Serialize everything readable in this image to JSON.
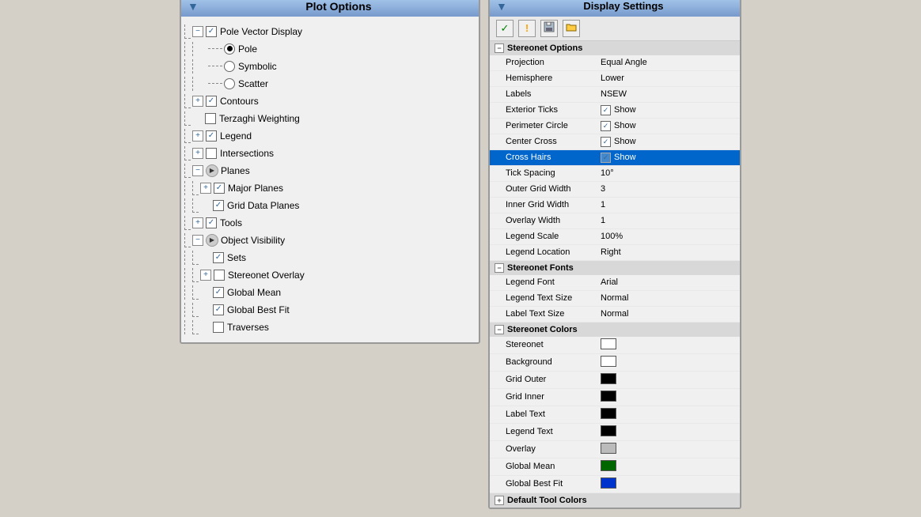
{
  "leftPanel": {
    "title": "Plot Options",
    "items": [
      {
        "label": "Pole Vector Display",
        "type": "minus-check",
        "checked": true,
        "indent": 0
      },
      {
        "label": "Pole",
        "type": "radio",
        "selected": true,
        "indent": 1
      },
      {
        "label": "Symbolic",
        "type": "radio",
        "selected": false,
        "indent": 1
      },
      {
        "label": "Scatter",
        "type": "radio",
        "selected": false,
        "indent": 1
      },
      {
        "label": "Contours",
        "type": "plus-check",
        "checked": true,
        "indent": 0
      },
      {
        "label": "Terzaghi Weighting",
        "type": "check",
        "checked": false,
        "indent": 0
      },
      {
        "label": "Legend",
        "type": "plus-check",
        "checked": true,
        "indent": 0
      },
      {
        "label": "Intersections",
        "type": "plus-check",
        "checked": false,
        "indent": 0
      },
      {
        "label": "Planes",
        "type": "minus-arrow",
        "indent": 0
      },
      {
        "label": "Major Planes",
        "type": "plus-check",
        "checked": true,
        "indent": 1
      },
      {
        "label": "Grid Data Planes",
        "type": "check",
        "checked": true,
        "indent": 1
      },
      {
        "label": "Tools",
        "type": "plus-check",
        "checked": true,
        "indent": 0
      },
      {
        "label": "Object Visibility",
        "type": "minus-arrow",
        "indent": 0
      },
      {
        "label": "Sets",
        "type": "check",
        "checked": true,
        "indent": 1
      },
      {
        "label": "Stereonet Overlay",
        "type": "plus-check",
        "checked": false,
        "indent": 1
      },
      {
        "label": "Global Mean",
        "type": "check",
        "checked": true,
        "indent": 1
      },
      {
        "label": "Global Best Fit",
        "type": "check",
        "checked": true,
        "indent": 1
      },
      {
        "label": "Traverses",
        "type": "check",
        "checked": false,
        "indent": 1
      }
    ]
  },
  "rightPanel": {
    "title": "Display Settings",
    "toolbar": {
      "checkmark": "✓",
      "exclaim": "!",
      "save": "💾",
      "folder": "📁"
    },
    "sections": [
      {
        "label": "Stereonet Options",
        "properties": [
          {
            "label": "Projection",
            "value": "Equal Angle",
            "type": "text"
          },
          {
            "label": "Hemisphere",
            "value": "Lower",
            "type": "text"
          },
          {
            "label": "Labels",
            "value": "NSEW",
            "type": "text"
          },
          {
            "label": "Exterior Ticks",
            "value": "Show",
            "type": "checkbox-show",
            "checked": true
          },
          {
            "label": "Perimeter Circle",
            "value": "Show",
            "type": "checkbox-show",
            "checked": true
          },
          {
            "label": "Center Cross",
            "value": "Show",
            "type": "checkbox-show",
            "checked": true
          },
          {
            "label": "Cross Hairs",
            "value": "Show",
            "type": "checkbox-show",
            "checked": true,
            "selected": true
          },
          {
            "label": "Tick Spacing",
            "value": "10°",
            "type": "text"
          },
          {
            "label": "Outer Grid Width",
            "value": "3",
            "type": "text"
          },
          {
            "label": "Inner Grid Width",
            "value": "1",
            "type": "text"
          },
          {
            "label": "Overlay Width",
            "value": "1",
            "type": "text"
          },
          {
            "label": "Legend Scale",
            "value": "100%",
            "type": "text"
          },
          {
            "label": "Legend Location",
            "value": "Right",
            "type": "text"
          }
        ]
      },
      {
        "label": "Stereonet Fonts",
        "properties": [
          {
            "label": "Legend Font",
            "value": "Arial",
            "type": "text"
          },
          {
            "label": "Legend Text Size",
            "value": "Normal",
            "type": "text"
          },
          {
            "label": "Label Text Size",
            "value": "Normal",
            "type": "text"
          }
        ]
      },
      {
        "label": "Stereonet Colors",
        "properties": [
          {
            "label": "Stereonet",
            "value": "",
            "type": "color",
            "color": "#ffffff"
          },
          {
            "label": "Background",
            "value": "",
            "type": "color",
            "color": "#ffffff"
          },
          {
            "label": "Grid Outer",
            "value": "",
            "type": "color",
            "color": "#000000"
          },
          {
            "label": "Grid Inner",
            "value": "",
            "type": "color",
            "color": "#000000"
          },
          {
            "label": "Label Text",
            "value": "",
            "type": "color",
            "color": "#000000"
          },
          {
            "label": "Legend Text",
            "value": "",
            "type": "color",
            "color": "#000000"
          },
          {
            "label": "Overlay",
            "value": "",
            "type": "color",
            "color": "#bbbbbb"
          },
          {
            "label": "Global Mean",
            "value": "",
            "type": "color",
            "color": "#006600"
          },
          {
            "label": "Global Best Fit",
            "value": "",
            "type": "color",
            "color": "#0033cc"
          }
        ]
      },
      {
        "label": "Default Tool Colors",
        "properties": []
      }
    ]
  }
}
